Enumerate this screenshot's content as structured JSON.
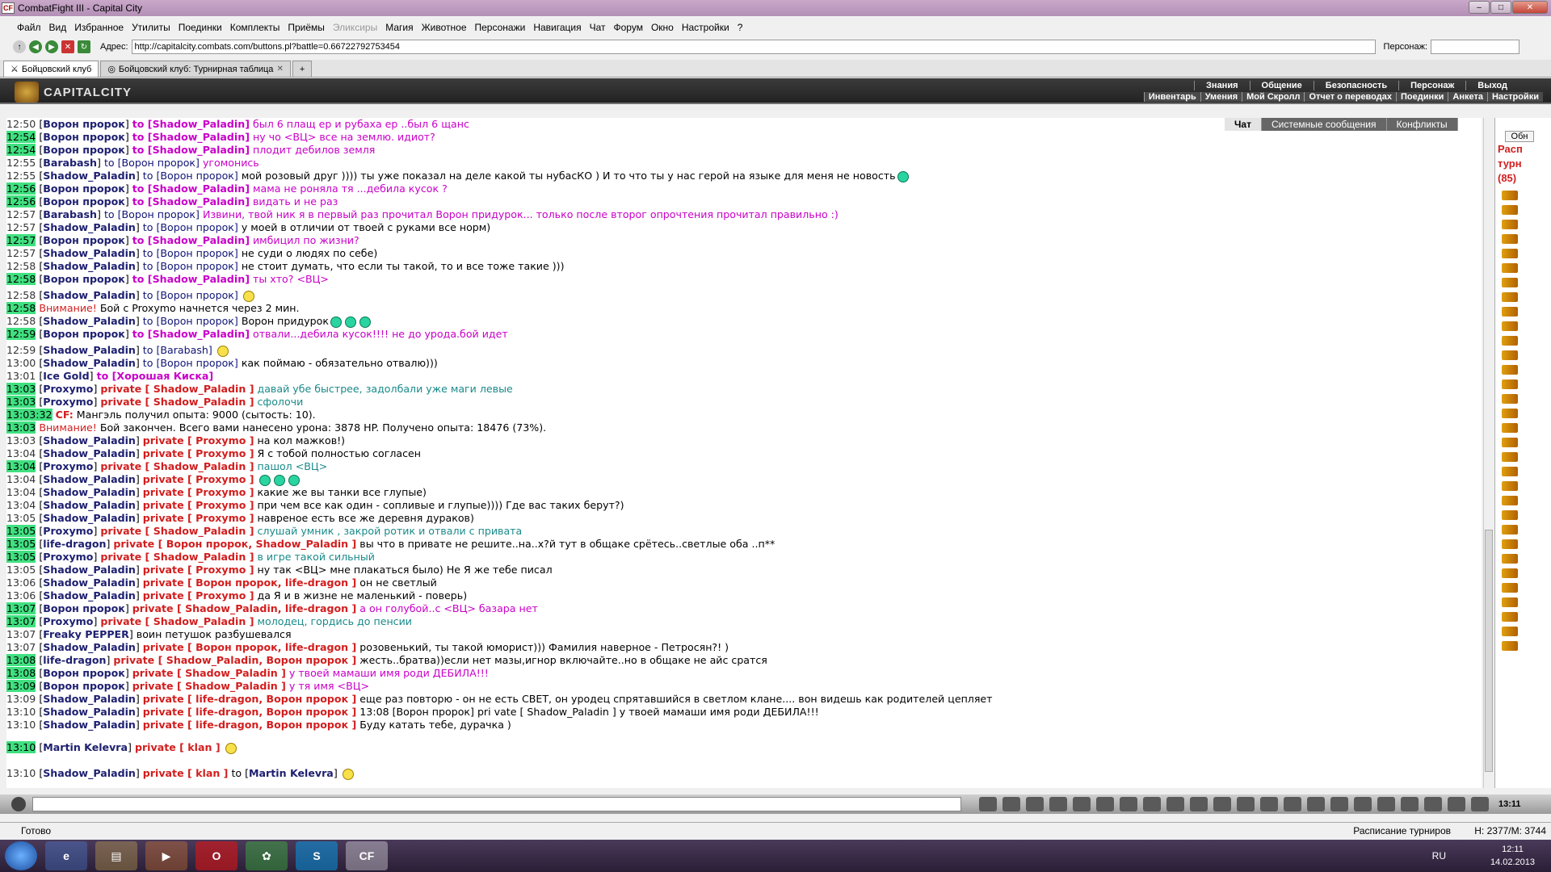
{
  "window": {
    "title": "CombatFight III - Capital City",
    "logo": "CF"
  },
  "menu": [
    "Файл",
    "Вид",
    "Избранное",
    "Утилиты",
    "Поединки",
    "Комплекты",
    "Приёмы",
    "Эликсиры",
    "Магия",
    "Животное",
    "Персонажи",
    "Навигация",
    "Чат",
    "Форум",
    "Окно",
    "Настройки",
    "?"
  ],
  "menu_disabled_index": 7,
  "address": {
    "label": "Адрес:",
    "url": "http://capitalcity.combats.com/buttons.pl?battle=0.6672279275345​4",
    "persona_label": "Персонаж:"
  },
  "tabs": [
    {
      "label": "Бойцовский клуб",
      "active": true
    },
    {
      "label": "Бойцовский клуб: Турнирная таблица",
      "active": false
    }
  ],
  "game_header": {
    "brand": "CAPITALCITY",
    "top_links": [
      "Знания",
      "Общение",
      "Безопасность",
      "Персонаж",
      "Выход"
    ],
    "bottom_links": [
      "Инвентарь",
      "Умения",
      "Мой Скролл",
      "Отчет о переводах",
      "Поединки",
      "Анкета",
      "Настройки"
    ]
  },
  "chat_tabs": [
    "Чат",
    "Системные сообщения",
    "Конфликты"
  ],
  "right_panel": {
    "button": "Обн",
    "title_l1": "Расп",
    "title_l2": "турн",
    "title_l3": "(85)"
  },
  "chat_lines": [
    {
      "t": "12:50",
      "hl": false,
      "nick": "Ворон пророк",
      "kind": "to",
      "target": "Shadow_Paladin",
      "msg": "был 6 плащ ер и рубаха ер ..был 6 щанс",
      "color": "p"
    },
    {
      "t": "12:54",
      "hl": true,
      "nick": "Ворон пророк",
      "kind": "to",
      "target": "Shadow_Paladin",
      "msg": "ну чо <ВЦ> все на землю. идиот?",
      "color": "p"
    },
    {
      "t": "12:54",
      "hl": true,
      "nick": "Ворон пророк",
      "kind": "to",
      "target": "Shadow_Paladin",
      "msg": "плодит дебилов земля",
      "color": "p"
    },
    {
      "t": "12:55",
      "hl": false,
      "nick": "Barabash",
      "kind": "to",
      "target": "Ворон пророк",
      "msg": "угомонись",
      "color": "ok"
    },
    {
      "t": "12:55",
      "hl": false,
      "nick": "Shadow_Paladin",
      "kind": "to",
      "target": "Ворон пророк",
      "msg": "мой розовый друг )))) ты уже показал на деле какой ты нубасКО ) И то что ты у нас герой на языке для меня не новость",
      "color": "ok",
      "smiles": 1
    },
    {
      "t": "12:56",
      "hl": true,
      "nick": "Ворон пророк",
      "kind": "to",
      "target": "Shadow_Paladin",
      "msg": "мама не роняла тя ...дебила кусок ?",
      "color": "p"
    },
    {
      "t": "12:56",
      "hl": true,
      "nick": "Ворон пророк",
      "kind": "to",
      "target": "Shadow_Paladin",
      "msg": "видать и не раз",
      "color": "p"
    },
    {
      "t": "12:57",
      "hl": false,
      "nick": "Barabash",
      "kind": "to",
      "target": "Ворон пророк",
      "msg": "Извини, твой ник я в первый раз прочитал Ворон придурок... только после второг опрочтения прочитал правильно :)",
      "color": "ok"
    },
    {
      "t": "12:57",
      "hl": false,
      "nick": "Shadow_Paladin",
      "kind": "to",
      "target": "Ворон пророк",
      "msg": "у моей в отличии от твоей с руками все норм)",
      "color": "ok"
    },
    {
      "t": "12:57",
      "hl": true,
      "nick": "Ворон пророк",
      "kind": "to",
      "target": "Shadow_Paladin",
      "msg": "имбицил по жизни?",
      "color": "p"
    },
    {
      "t": "12:57",
      "hl": false,
      "nick": "Shadow_Paladin",
      "kind": "to",
      "target": "Ворон пророк",
      "msg": "не суди о людях по себе)",
      "color": "ok"
    },
    {
      "t": "12:58",
      "hl": false,
      "nick": "Shadow_Paladin",
      "kind": "to",
      "target": "Ворон пророк",
      "msg": "не стоит думать, что если ты такой, то и все тоже такие )))",
      "color": "ok"
    },
    {
      "t": "12:58",
      "hl": true,
      "nick": "Ворон пророк",
      "kind": "to",
      "target": "Shadow_Paladin",
      "msg": "ты хто? <ВЦ>",
      "color": "p"
    },
    {
      "t": "12:58",
      "hl": false,
      "nick": "Shadow_Paladin",
      "kind": "to",
      "target": "Ворон пророк",
      "msg": "",
      "color": "ok",
      "smiles": 1,
      "yellow": true
    },
    {
      "t": "12:58",
      "hl": true,
      "kind": "warn",
      "msg": "Внимание!",
      "rest": "Бой с Proxymo начнется через 2 мин."
    },
    {
      "t": "12:58",
      "hl": false,
      "nick": "Shadow_Paladin",
      "kind": "to",
      "target": "Ворон пророк",
      "msg": "Ворон придурок",
      "color": "ok",
      "smiles": 3
    },
    {
      "t": "12:59",
      "hl": true,
      "nick": "Ворон пророк",
      "kind": "to",
      "target": "Shadow_Paladin",
      "msg": "отвали...дебила кусок!!!! не до урода.бой идет",
      "color": "p"
    },
    {
      "t": "12:59",
      "hl": false,
      "nick": "Shadow_Paladin",
      "kind": "to",
      "target": "Barabash",
      "msg": "",
      "color": "ok",
      "smiles": 1,
      "yellow": true
    },
    {
      "t": "13:00",
      "hl": false,
      "nick": "Shadow_Paladin",
      "kind": "to",
      "target": "Ворон пророк",
      "msg": "как поймаю - обязательно отвалю)))",
      "color": "ok"
    },
    {
      "t": "13:01",
      "hl": false,
      "nick": "Ice Gold",
      "kind": "to",
      "target": "Хорошая Киска",
      "msg": "",
      "color": "p"
    },
    {
      "t": "13:03",
      "hl": true,
      "nick": "Proxymo",
      "kind": "priv",
      "target": "Shadow_Paladin",
      "msg": "давай убе быстрее, задолбали уже маги левые",
      "color": "teal"
    },
    {
      "t": "13:03",
      "hl": true,
      "nick": "Proxymo",
      "kind": "priv",
      "target": "Shadow_Paladin",
      "msg": "сфолочи",
      "color": "teal"
    },
    {
      "t": "13:03:32",
      "hl": true,
      "kind": "cf",
      "msg": "CF:",
      "rest": "Мангэль получил опыта: 9000 (сытость: 10)."
    },
    {
      "t": "13:03",
      "hl": true,
      "kind": "warn",
      "msg": "Внимание!",
      "rest": "Бой закончен. Всего вами нанесено урона: 3878 HP. Получено опыта: 18476 (73%)."
    },
    {
      "t": "13:03",
      "hl": false,
      "nick": "Shadow_Paladin",
      "kind": "priv",
      "target": "Proxymo",
      "msg": "на кол мажков!)",
      "color": "ok"
    },
    {
      "t": "13:04",
      "hl": false,
      "nick": "Shadow_Paladin",
      "kind": "priv",
      "target": "Proxymo",
      "msg": "Я с тобой полностью согласен",
      "color": "ok"
    },
    {
      "t": "13:04",
      "hl": true,
      "nick": "Proxymo",
      "kind": "priv",
      "target": "Shadow_Paladin",
      "msg": "пашол <ВЦ>",
      "color": "teal"
    },
    {
      "t": "13:04",
      "hl": false,
      "nick": "Shadow_Paladin",
      "kind": "priv",
      "target": "Proxymo",
      "msg": "",
      "color": "ok",
      "smiles": 3
    },
    {
      "t": "13:04",
      "hl": false,
      "nick": "Shadow_Paladin",
      "kind": "priv",
      "target": "Proxymo",
      "msg": "какие же вы танки все глупые)",
      "color": "ok"
    },
    {
      "t": "13:04",
      "hl": false,
      "nick": "Shadow_Paladin",
      "kind": "priv",
      "target": "Proxymo",
      "msg": "при чем все как один - сопливые и глупые)))) Где вас таких берут?)",
      "color": "ok"
    },
    {
      "t": "13:05",
      "hl": false,
      "nick": "Shadow_Paladin",
      "kind": "priv",
      "target": "Proxymo",
      "msg": "навреное есть все же деревня дураков)",
      "color": "ok"
    },
    {
      "t": "13:05",
      "hl": true,
      "nick": "Proxymo",
      "kind": "priv",
      "target": "Shadow_Paladin",
      "msg": "слушай умник , закрой ротик и отвали с привата",
      "color": "teal"
    },
    {
      "t": "13:05",
      "hl": true,
      "nick": "life-dragon",
      "kind": "priv",
      "target": "Ворон пророк, Shadow_Paladin",
      "msg": "вы что в привате не решите..на..х?й тут в общаке срётесь..светлые оба ..п**",
      "color": "ok"
    },
    {
      "t": "13:05",
      "hl": true,
      "nick": "Proxymo",
      "kind": "priv",
      "target": "Shadow_Paladin",
      "msg": "в игре такой сильный",
      "color": "teal"
    },
    {
      "t": "13:05",
      "hl": false,
      "nick": "Shadow_Paladin",
      "kind": "priv",
      "target": "Proxymo",
      "msg": "ну так <ВЦ> мне плакаться было) Не Я же тебе писал",
      "color": "ok"
    },
    {
      "t": "13:06",
      "hl": false,
      "nick": "Shadow_Paladin",
      "kind": "priv",
      "target": "Ворон пророк, life-dragon",
      "msg": "он не светлый",
      "color": "ok"
    },
    {
      "t": "13:06",
      "hl": false,
      "nick": "Shadow_Paladin",
      "kind": "priv",
      "target": "Proxymo",
      "msg": "да Я и в жизне не маленький - поверь)",
      "color": "ok"
    },
    {
      "t": "13:07",
      "hl": true,
      "nick": "Ворон пророк",
      "kind": "priv",
      "target": "Shadow_Paladin, life-dragon",
      "msg": "а он голубой..с <ВЦ> базара нет",
      "color": "p"
    },
    {
      "t": "13:07",
      "hl": true,
      "nick": "Proxymo",
      "kind": "priv",
      "target": "Shadow_Paladin",
      "msg": "молодец, гордись до пенсии",
      "color": "teal"
    },
    {
      "t": "13:07",
      "hl": false,
      "nick": "Freaky PEPPER",
      "kind": "plain",
      "msg": "воин петушок разбушевался",
      "color": "ok"
    },
    {
      "t": "13:07",
      "hl": false,
      "nick": "Shadow_Paladin",
      "kind": "priv",
      "target": "Ворон пророк, life-dragon",
      "msg": "розовенький, ты такой юморист))) Фамилия наверное - Петросян?! )",
      "color": "ok"
    },
    {
      "t": "13:08",
      "hl": true,
      "nick": "life-dragon",
      "kind": "priv",
      "target": "Shadow_Paladin, Ворон пророк",
      "msg": "жесть..братва))если нет мазы,игнор включайте..но в общаке не айс сратся",
      "color": "ok"
    },
    {
      "t": "13:08",
      "hl": true,
      "nick": "Ворон пророк",
      "kind": "priv",
      "target": "Shadow_Paladin",
      "msg": "у твоей мамаши имя роди ДЕБИЛА!!!",
      "color": "p"
    },
    {
      "t": "13:09",
      "hl": true,
      "nick": "Ворон пророк",
      "kind": "priv",
      "target": "Shadow_Paladin",
      "msg": "у тя имя <ВЦ>",
      "color": "p"
    },
    {
      "t": "13:09",
      "hl": false,
      "nick": "Shadow_Paladin",
      "kind": "priv",
      "target": "life-dragon, Ворон пророк",
      "msg": "еще раз повторю - он не есть СВЕТ, он уродец спрятавшийся в светлом клане.... вон видешь как родителей цепляет",
      "color": "ok"
    },
    {
      "t": "13:10",
      "hl": false,
      "nick": "Shadow_Paladin",
      "kind": "priv",
      "target": "life-dragon, Ворон пророк",
      "msg": "13:08 [Ворон пророк] pri vate [ Shadow_Paladin ] у твоей мамаши имя роди ДЕБИЛА!!!",
      "color": "ok"
    },
    {
      "t": "13:10",
      "hl": false,
      "nick": "Shadow_Paladin",
      "kind": "priv",
      "target": "life-dragon, Ворон пророк",
      "msg": "Буду катать тебе, дурачка )",
      "color": "ok"
    },
    {
      "t": "13:10",
      "hl": true,
      "nick": "Martin Kelevra",
      "kind": "priv",
      "target": "klan",
      "msg": "",
      "color": "ok",
      "smiles": 1,
      "yellow": true,
      "tall": true
    },
    {
      "t": "13:10",
      "hl": false,
      "nick": "Shadow_Paladin",
      "kind": "privto",
      "target": "klan",
      "to2": "Martin Kelevra",
      "msg": "",
      "color": "ok",
      "smiles": 1,
      "yellow": true,
      "tall": true
    }
  ],
  "status": {
    "ready": "Готово",
    "schedule": "Расписание турниров",
    "mem": "Н: 2377/М: 3744"
  },
  "clock": {
    "time": "12:11",
    "date": "14.02.2013",
    "lang": "RU"
  },
  "input_clock": "13:11"
}
